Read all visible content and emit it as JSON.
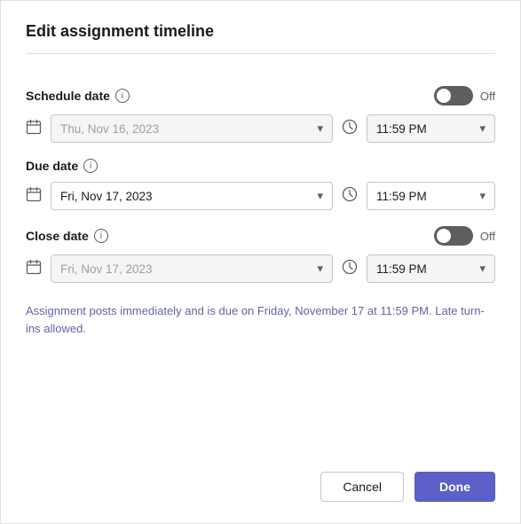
{
  "dialog": {
    "title": "Edit assignment timeline"
  },
  "schedule_date": {
    "label": "Schedule date",
    "info": "i",
    "toggle_state": "off",
    "toggle_label": "Off",
    "date_placeholder": "Thu, Nov 16, 2023",
    "time_value": "11:59 PM"
  },
  "due_date": {
    "label": "Due date",
    "info": "i",
    "date_value": "Fri, Nov 17, 2023",
    "time_value": "11:59 PM"
  },
  "close_date": {
    "label": "Close date",
    "info": "i",
    "toggle_state": "off",
    "toggle_label": "Off",
    "date_placeholder": "Fri, Nov 17, 2023",
    "time_value": "11:59 PM"
  },
  "info_text": "Assignment posts immediately and is due on Friday, November 17 at 11:59 PM. Late turn-ins allowed.",
  "footer": {
    "cancel_label": "Cancel",
    "done_label": "Done"
  }
}
